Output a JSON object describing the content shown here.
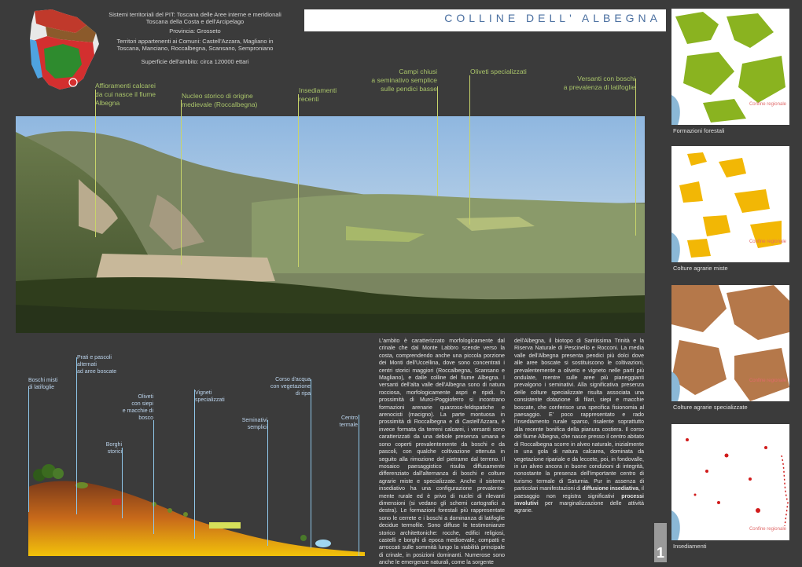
{
  "header": {
    "line1": "Sistemi territoriali del PIT:  Toscana delle Aree interne e meridionali",
    "line2": "Toscana della Costa e dell'Arcipelago",
    "province": "Provincia: Grosseto",
    "municipalities_1": "Territori appartenenti ai Comuni: Castell'Azzara, Magliano in",
    "municipalities_2": "Toscana, Manciano, Roccalbegna, Scansano, Semproniano",
    "surface": "Superficie dell'ambito: circa 120000 ettari",
    "title": "COLLINE  DELL' ALBEGNA"
  },
  "photo_labels": {
    "affioramenti": [
      "Affioramenti calcarei",
      "da cui nasce il fiume",
      "Albegna"
    ],
    "nucleo": [
      "Nucleo storico di origine",
      "medievale (Roccalbegna)"
    ],
    "insediamenti": [
      "Insediamenti",
      "recenti"
    ],
    "campi": [
      "Campi chiusi",
      "a seminativo semplice",
      "sulle pendici basse"
    ],
    "oliveti": [
      "Oliveti specializzati"
    ],
    "versanti": [
      "Versanti con boschi",
      "a prevalenza di latifoglie"
    ]
  },
  "maps": [
    {
      "caption": "Formazioni forestali",
      "confine": "Confine regionale",
      "color": "#8ab320"
    },
    {
      "caption": "Colture agrarie miste",
      "confine": "Confine regionale",
      "color": "#f2b705"
    },
    {
      "caption": "Colture agrarie specializzate",
      "confine": "Confine regionale",
      "color": "#b5784a"
    },
    {
      "caption": "Insediamenti",
      "confine": "Confine regionale",
      "color": "#d11b1b"
    }
  ],
  "section_labels": {
    "prati": [
      "Prati e pascoli",
      "alternati",
      "ad aree boscate"
    ],
    "boschi": [
      "Boschi misti",
      "di latifoglie"
    ],
    "oliveti": [
      "Oliveti",
      "con siepi",
      "e macchie di",
      "bosco"
    ],
    "vigneti": [
      "Vigneti",
      "specializzati"
    ],
    "corso": [
      "Corso d'acqua",
      "con vegetazione",
      "di ripa"
    ],
    "seminativi": [
      "Seminativi",
      "semplici"
    ],
    "centro": [
      "Centro",
      "termale"
    ],
    "borghi": [
      "Borghi",
      "storici"
    ]
  },
  "text_col1": "L'ambito è caratterizzato morfologicamente dal crinale che dal Monte Labbro scende verso la costa, comprendendo anche una piccola porzione dei Monti dell'Uccellina, dove sono concentrati i centri storici maggiori (Roccalbegna, Scansano e Magliano), e dalle colline del fiume Albegna. I versanti dell'alta valle dell'Albegna sono di natura rocciosa, morfologicamente aspri e ripidi. In prossimità di Murci-Poggioferro si incontrano formazioni arenarie quarzoso-feldspatiche e arenocisti (macigno). La parte montuosa in prossimità di Roccalbegna e di Castell'Azzara, è invece formata da terreni calcarei, i versanti sono caratterizzati da una debole presenza umana e sono coperti prevalentemente da boschi e da pascoli, con qualche coltivazione ottenuta in seguito alla rimozione del pietrame dal terreno. Il mosaico paesaggistico risulta diffusamente differenziato dall'alternanza di boschi e colture agrarie miste e specializzate. Anche il sistema insediativo ha una configurazione prevalente- mente rurale ed è privo di nuclei di rilevanti dimensioni (si vedano gli schemi cartografici a destra). Le formazioni forestali più rappresentate sono le cerrete e i boschi a dominanza di latifoglie decidue termofile. Sono diffuse le testimonianze storico architettoniche: rocche, edifici religiosi, castelli e borghi di epoca medioevale, compatti e arroccati sulle sommità lungo la viabilità principale di crinale, in posizioni dominanti. Numerose sono anche le emergenze naturali, come la sorgente",
  "text_col2a": "dell'Albegna, il biotopo di Santissima Trinità e la Riserva Naturale di Pescinello e Rocconi. La media valle dell'Albegna presenta pendici più dolci dove alle aree boscate si sostituiscono le coltivazioni, prevalentemente a oliveto e vigneto nelle parti più ondulate, mentre sulle aree più pianeggianti prevalgono i seminativi. Alla significativa presenza delle colture specializzate risulta associata una consistente dotazione di filari, siepi e macchie boscate, che conferisce una specifica fisionomia al paesaggio. E' poco rappresentato e rado l'insediamento rurale sparso, risalente soprattutto alla recente bonifica della pianura costiera. Il corso del fiume Albegna, che nasce presso il centro abitato di Roccalbegna scorre in alveo naturale, inizialmente in una gola di natura calcarea, dominata da vegetazione ripariale e da leccete, poi, in fondovalle, in un alveo ancora in buone condizioni di integrità, nonostante la presenza dell'importante centro di turismo termale di Saturnia. Pur in assenza di particolari manifestazioni di",
  "text_col2_bold": "diffusione insediativa",
  "text_col2b": ", il paesaggio non registra significativi",
  "text_col2_bold2": "processi involutivi",
  "text_col2c": "per marginalizzazione delle attività agrarie.",
  "page_number": "1"
}
